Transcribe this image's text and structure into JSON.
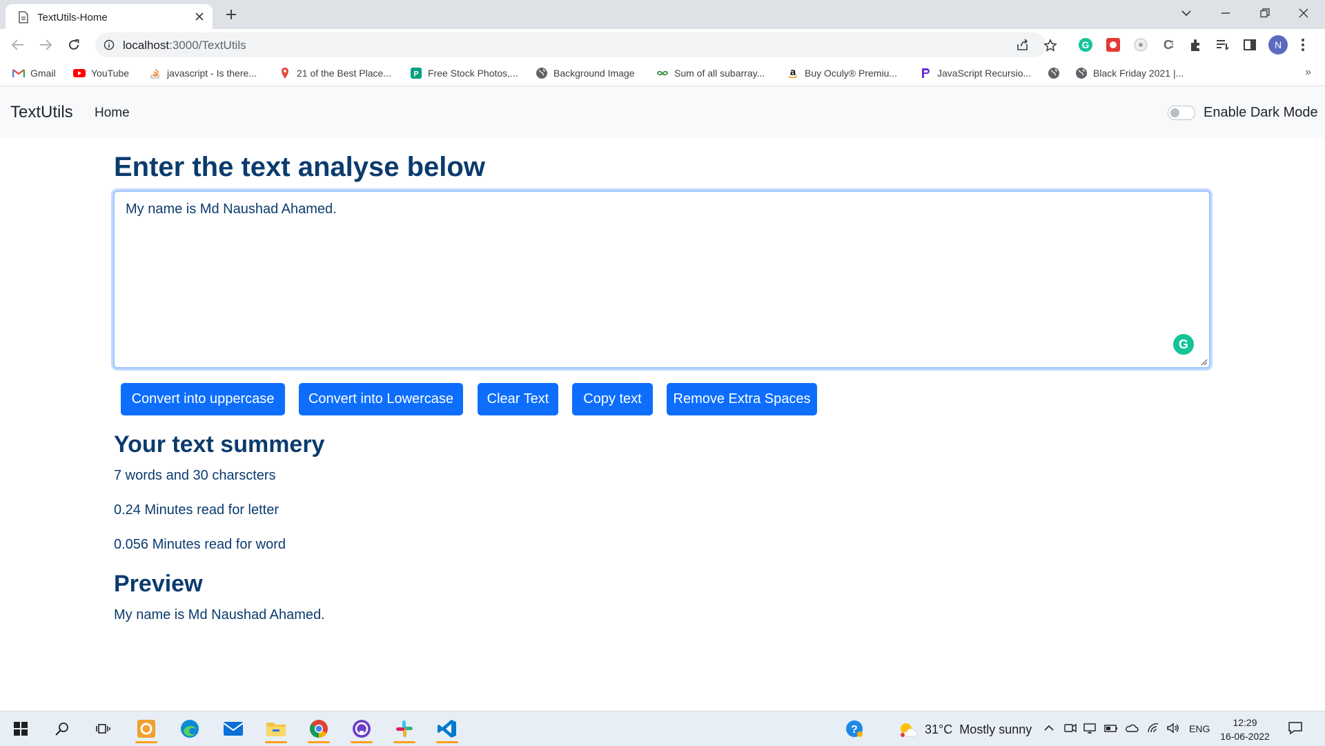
{
  "browser": {
    "tab_title": "TextUtils-Home",
    "url_host": "localhost",
    "url_path": ":3000/TextUtils",
    "avatar_letter": "N",
    "bookmarks": [
      {
        "label": "Gmail",
        "icon": "gmail-icon"
      },
      {
        "label": "YouTube",
        "icon": "youtube-icon"
      },
      {
        "label": "javascript - Is there...",
        "icon": "stackoverflow-icon"
      },
      {
        "label": "21 of the Best Place...",
        "icon": "pin-icon"
      },
      {
        "label": "Free Stock Photos,...",
        "icon": "pexels-icon"
      },
      {
        "label": "Background Image",
        "icon": "globe-icon"
      },
      {
        "label": "Sum of all subarray...",
        "icon": "gfg-icon"
      },
      {
        "label": "Buy Oculy® Premiu...",
        "icon": "amazon-icon"
      },
      {
        "label": "JavaScript Recursio...",
        "icon": "programiz-icon"
      },
      {
        "label": "",
        "icon": "globe-icon"
      },
      {
        "label": "Black Friday 2021 |...",
        "icon": "globe-icon"
      }
    ],
    "bookmarks_more": "»"
  },
  "app": {
    "brand": "TextUtils",
    "nav_home": "Home",
    "dark_mode_label": "Enable Dark Mode",
    "dark_mode_enabled": false,
    "heading": "Enter the text analyse below",
    "textarea_value": "My name is Md Naushad Ahamed.",
    "buttons": {
      "uppercase": "Convert into uppercase",
      "lowercase": "Convert into Lowercase",
      "clear": "Clear Text",
      "copy": "Copy text",
      "remove_spaces": "Remove Extra Spaces"
    },
    "summary_heading": "Your text summery",
    "summary_counts": "7 words and 30 charscters",
    "read_letter": "0.24 Minutes read for letter",
    "read_word": "0.056 Minutes read for word",
    "preview_heading": "Preview",
    "preview_text": "My name is Md Naushad Ahamed."
  },
  "taskbar": {
    "weather_temp": "31°C",
    "weather_desc": "Mostly sunny",
    "lang": "ENG",
    "time": "12:29",
    "date": "16-06-2022"
  },
  "colors": {
    "primary": "#0d6efd",
    "heading": "#0b3b6e",
    "navbar_bg": "#f8f9fa"
  }
}
